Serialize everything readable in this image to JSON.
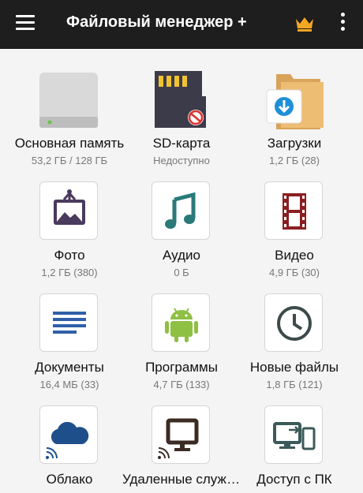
{
  "app_bar": {
    "title": "Файловый менеджер +",
    "menu_icon": "hamburger-menu-icon",
    "premium_icon": "crown-icon",
    "overflow_icon": "more-vert-icon",
    "crown_color": "#f5a623"
  },
  "tiles": [
    {
      "label": "Основная память",
      "sub": "53,2 ГБ / 128 ГБ",
      "icon": "hard-drive-icon"
    },
    {
      "label": "SD-карта",
      "sub": "Недоступно",
      "icon": "sd-card-icon"
    },
    {
      "label": "Загрузки",
      "sub": "1,2 ГБ (28)",
      "icon": "downloads-folder-icon"
    },
    {
      "label": "Фото",
      "sub": "1,2 ГБ (380)",
      "icon": "photo-icon",
      "color": "#4a3a5e"
    },
    {
      "label": "Аудио",
      "sub": "0 Б",
      "icon": "music-note-icon",
      "color": "#2a7a78"
    },
    {
      "label": "Видео",
      "sub": "4,9 ГБ (30)",
      "icon": "film-icon",
      "color": "#8b1e22"
    },
    {
      "label": "Документы",
      "sub": "16,4 МБ (33)",
      "icon": "document-lines-icon",
      "color": "#2f5fa8"
    },
    {
      "label": "Программы",
      "sub": "4,7 ГБ (133)",
      "icon": "android-icon",
      "color": "#8dc043"
    },
    {
      "label": "Новые файлы",
      "sub": "1,8 ГБ (121)",
      "icon": "clock-icon",
      "color": "#3c4a4a"
    },
    {
      "label": "Облако",
      "sub": "",
      "icon": "cloud-icon",
      "color": "#1f4f8a"
    },
    {
      "label": "Удаленные службы",
      "sub": "",
      "icon": "remote-monitor-icon",
      "color": "#3b2b22"
    },
    {
      "label": "Доступ с ПК",
      "sub": "",
      "icon": "pc-phone-access-icon",
      "color": "#3c5a5a"
    }
  ]
}
